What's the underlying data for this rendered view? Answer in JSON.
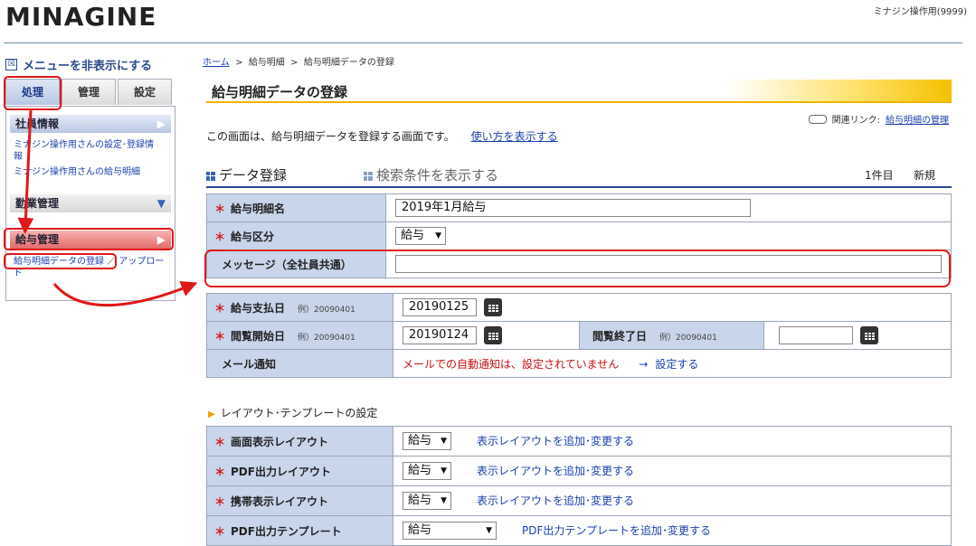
{
  "header": {
    "logo": "MINAGINE",
    "user": "ミナジン操作用(9999)"
  },
  "sidebar": {
    "toggle_icon": "☒",
    "toggle_label": "メニューを非表示にする",
    "tabs": [
      "処理",
      "管理",
      "設定"
    ],
    "sections": [
      {
        "label": "社員情報",
        "arrow": "▶"
      },
      {
        "label": "勤業管理",
        "arrow": "▼"
      },
      {
        "label": "給与管理",
        "arrow": "▶"
      }
    ],
    "employee_links": [
      "ミナジン操作用さんの設定･登録情報",
      "ミナジン操作用さんの給与明細"
    ],
    "payroll_link": "給与明細データの登録",
    "payroll_sep": "／",
    "upload_link": "アップロード"
  },
  "breadcrumb": {
    "home": "ホーム",
    "sep1": ">",
    "item1": "給与明細",
    "sep2": ">",
    "item2": "給与明細データの登録"
  },
  "page": {
    "title": "給与明細データの登録",
    "related_label": "関連リンク:",
    "related_link": "給与明細の管理",
    "intro": "この画面は、給与明細データを登録する画面です。",
    "howto_link": "使い方を表示する"
  },
  "section": {
    "title": "データ登録",
    "search_toggle": "検索条件を表示する",
    "count": "1件目",
    "new": "新規"
  },
  "form1": {
    "required_mark": "＊",
    "name_label": "給与明細名",
    "name_value": "2019年1月給与",
    "type_label": "給与区分",
    "type_value": "給与",
    "message_label": "メッセージ（全社員共通）",
    "message_value": ""
  },
  "form2": {
    "pay_date_label": "給与支払日",
    "example": "例）20090401",
    "pay_date_value": "20190125",
    "view_start_label": "閲覧開始日",
    "view_start_value": "20190124",
    "view_end_label": "閲覧終了日",
    "view_end_value": "",
    "mail_label": "メール通知",
    "mail_status": "メールでの自動通知は、設定されていません",
    "mail_arrow": "→",
    "mail_link": "設定する"
  },
  "layout": {
    "heading": "レイアウト･テンプレートの設定",
    "rows": [
      {
        "label": "画面表示レイアウト",
        "value": "給与",
        "link": "表示レイアウトを追加･変更する"
      },
      {
        "label": "PDF出力レイアウト",
        "value": "給与",
        "link": "表示レイアウトを追加･変更する"
      },
      {
        "label": "携帯表示レイアウト",
        "value": "給与",
        "link": "表示レイアウトを追加･変更する"
      },
      {
        "label": "PDF出力テンプレート",
        "value": "給与",
        "link": "PDF出力テンプレートを追加･変更する"
      }
    ]
  },
  "colors": {
    "accent_red": "#e01818",
    "nav_blue": "#2b4a8c",
    "label_bg": "#c8d5ea"
  }
}
